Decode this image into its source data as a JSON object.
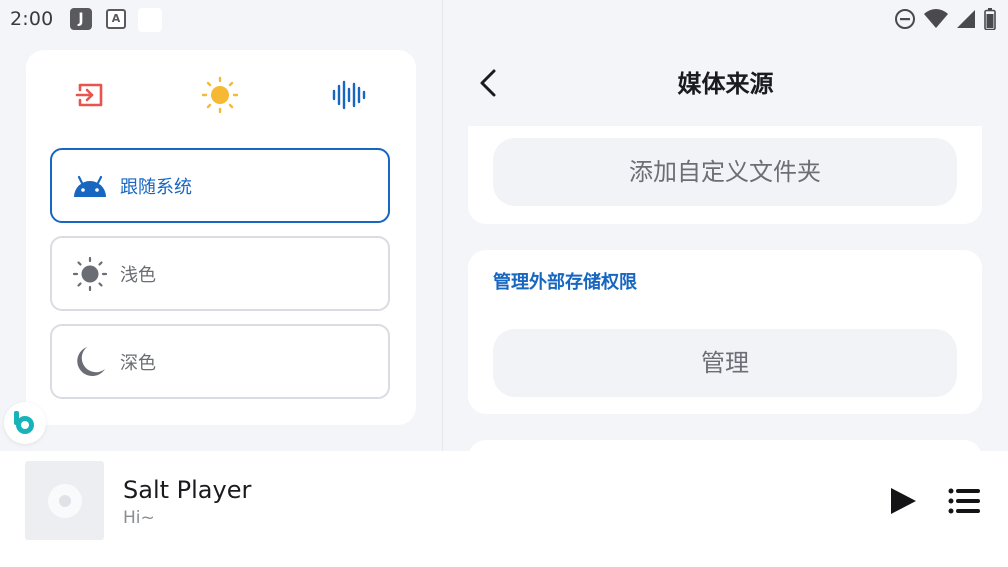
{
  "status_bar": {
    "time": "2:00",
    "icons": [
      "app-j-icon",
      "app-a-icon",
      "blank-notification-icon",
      "do-not-disturb-icon",
      "wifi-icon",
      "signal-icon",
      "battery-icon"
    ],
    "app_j_letter": "J",
    "app_a_letter": "A"
  },
  "theme_panel": {
    "mode_icons": [
      "exit-icon",
      "sun-icon",
      "waveform-icon"
    ],
    "options": [
      {
        "label": "跟随系统",
        "icon": "android-icon",
        "selected": true
      },
      {
        "label": "浅色",
        "icon": "sun-outline-icon",
        "selected": false
      },
      {
        "label": "深色",
        "icon": "moon-icon",
        "selected": false
      }
    ]
  },
  "media_source": {
    "title": "媒体来源",
    "add_folder_label": "添加自定义文件夹",
    "storage_section_title": "管理外部存储权限",
    "manage_label": "管理"
  },
  "player": {
    "title": "Salt Player",
    "subtitle": "Hi~"
  },
  "colors": {
    "accent": "#1766c0",
    "exit_icon": "#e8544e",
    "sun_icon": "#f6b936",
    "waveform_icon": "#1766c0",
    "floating_badge": "#17b3b9"
  }
}
